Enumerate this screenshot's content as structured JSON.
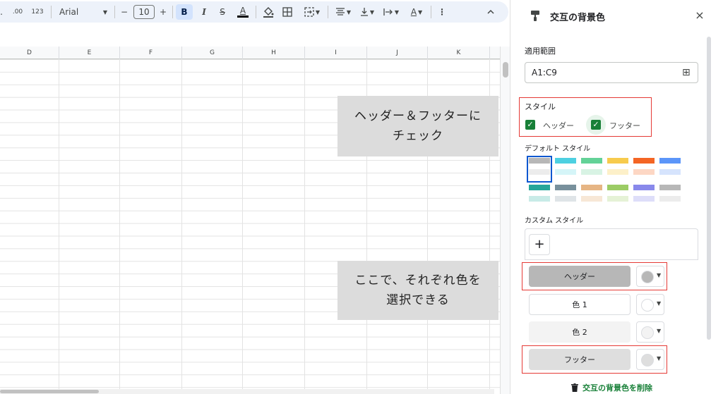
{
  "toolbar": {
    "decimal_increase": ".00",
    "number_format": "123",
    "font_name": "Arial",
    "font_size": "10",
    "bold": "B",
    "italic": "I",
    "strike": "S",
    "text_color": "A",
    "minus": "−",
    "plus": "+",
    "more": "⋮",
    "collapse": "^"
  },
  "columns": [
    "D",
    "E",
    "F",
    "G",
    "H",
    "I",
    "J",
    "K"
  ],
  "notes": {
    "note1": "ヘッダー＆フッターに\nチェック",
    "note2": "ここで、それぞれ色を\n選択できる"
  },
  "panel": {
    "title": "交互の背景色",
    "close": "×",
    "range_label": "適用範囲",
    "range_value": "A1:C9",
    "style_label": "スタイル",
    "header_check_label": "ヘッダー",
    "footer_check_label": "フッター",
    "default_styles_label": "デフォルト スタイル",
    "custom_styles_label": "カスタム スタイル",
    "add_custom": "+",
    "style_rows": [
      {
        "label": "ヘッダー",
        "bg": "#b7b7b7",
        "dot": "#b7b7b7"
      },
      {
        "label": "色 1",
        "bg": "#ffffff",
        "dot": "#ffffff"
      },
      {
        "label": "色 2",
        "bg": "#f3f3f3",
        "dot": "#f3f3f3"
      },
      {
        "label": "フッター",
        "bg": "#dedede",
        "dot": "#dedede"
      }
    ],
    "remove_label": "交互の背景色を削除"
  },
  "colors": {
    "accent_green": "#188038",
    "highlight_red": "#e53935",
    "toolbar_bg": "#edf2fa"
  },
  "default_swatches": [
    {
      "h": "#b7b7b7",
      "a": "#ffffff",
      "b": "#ececec"
    },
    {
      "h": "#4dd0e1",
      "a": "#ffffff",
      "b": "#d5f5f8"
    },
    {
      "h": "#63d297",
      "a": "#ffffff",
      "b": "#d8f3e4"
    },
    {
      "h": "#f7cb4d",
      "a": "#ffffff",
      "b": "#fdf0c9"
    },
    {
      "h": "#f46524",
      "a": "#ffffff",
      "b": "#fdd7c4"
    },
    {
      "h": "#5b95f9",
      "a": "#ffffff",
      "b": "#d6e4fd"
    },
    {
      "h": "#26a69a",
      "a": "#ffffff",
      "b": "#c8ebe7"
    },
    {
      "h": "#78909c",
      "a": "#ffffff",
      "b": "#dfe4e7"
    },
    {
      "h": "#e6b584",
      "a": "#ffffff",
      "b": "#f7e7d6"
    },
    {
      "h": "#9ccc65",
      "a": "#ffffff",
      "b": "#e5f2d6"
    },
    {
      "h": "#8989eb",
      "a": "#ffffff",
      "b": "#dedef9"
    },
    {
      "h": "#b7b7b7",
      "a": "#ffffff",
      "b": "#ececec"
    }
  ]
}
